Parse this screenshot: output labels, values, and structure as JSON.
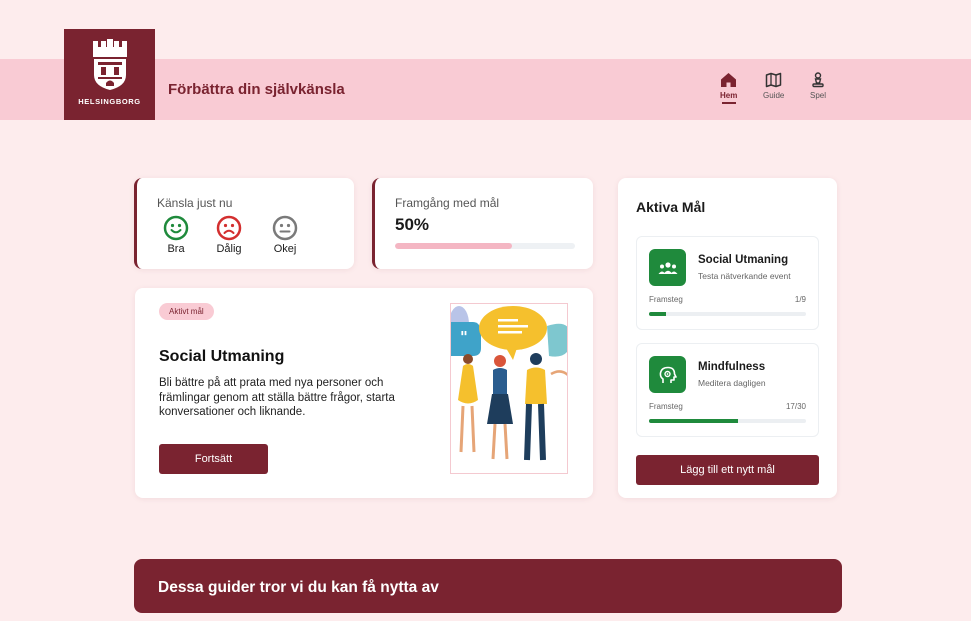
{
  "header": {
    "logo_text": "HELSINGBORG",
    "app_title": "Förbättra din självkänsla",
    "nav": [
      {
        "label": "Hem",
        "icon": "home-icon",
        "active": true
      },
      {
        "label": "Guide",
        "icon": "map-icon",
        "active": false
      },
      {
        "label": "Spel",
        "icon": "chess-pawn-icon",
        "active": false
      }
    ]
  },
  "mood": {
    "title": "Känsla just nu",
    "options": [
      {
        "label": "Bra",
        "icon": "happy-face-icon",
        "color": "#1f8a3c"
      },
      {
        "label": "Dålig",
        "icon": "sad-face-icon",
        "color": "#d32f2f"
      },
      {
        "label": "Okej",
        "icon": "neutral-face-icon",
        "color": "#7a7a7a"
      }
    ]
  },
  "progress": {
    "title": "Framgång med mål",
    "value_text": "50%",
    "fraction": 0.65
  },
  "featured": {
    "badge": "Aktivt mål",
    "title": "Social Utmaning",
    "description": "Bli bättre på att prata med nya personer och främlingar genom att ställa bättre frågor, starta konversationer och liknande.",
    "button": "Fortsätt"
  },
  "goals": {
    "title": "Aktiva Mål",
    "items": [
      {
        "name": "Social Utmaning",
        "subtitle": "Testa nätverkande event",
        "progress_label": "Framsteg",
        "count": "1/9",
        "fraction": 0.111,
        "icon": "group-icon"
      },
      {
        "name": "Mindfulness",
        "subtitle": "Meditera dagligen",
        "progress_label": "Framsteg",
        "count": "17/30",
        "fraction": 0.567,
        "icon": "mind-icon"
      }
    ],
    "add_button": "Lägg till ett nytt mål"
  },
  "banner": {
    "text": "Dessa guider tror vi du kan få nytta av"
  },
  "colors": {
    "brand": "#7a2330",
    "header_band": "#f9cbd4",
    "background": "#fdeced",
    "goal_green": "#1f8a3c"
  }
}
